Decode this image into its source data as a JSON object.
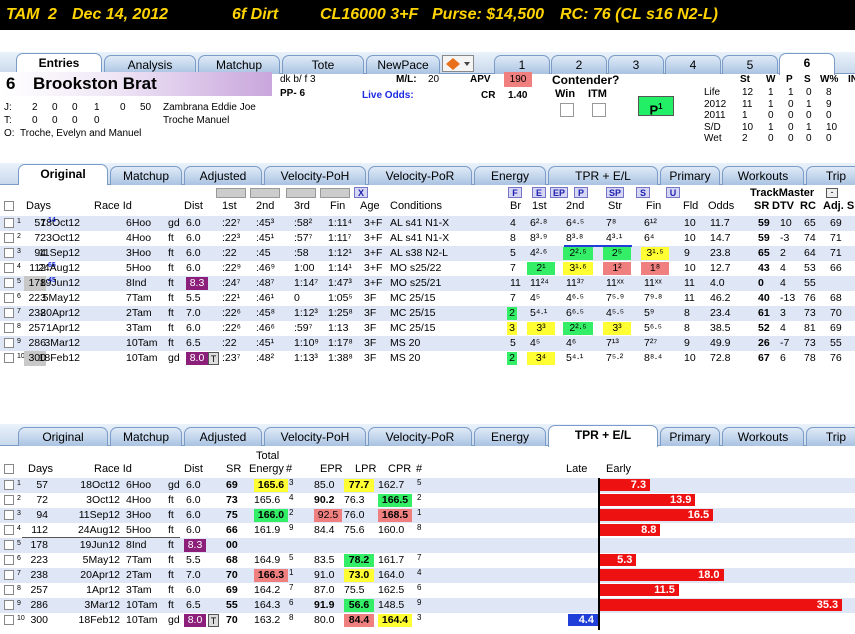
{
  "title": {
    "track": "TAM",
    "race": "2",
    "date": "Dec 14, 2012",
    "dist_surface": "6f  Dirt",
    "class": "CL16000  3+F",
    "purse": "Purse: $14,500",
    "rc": "RC: 76  (CL s16 N2-L)"
  },
  "top_tabs": [
    "Entries",
    "Analysis",
    "Matchup",
    "Tote",
    "NewPace"
  ],
  "race_tabs": [
    "1",
    "2",
    "3",
    "4",
    "5",
    "6"
  ],
  "horse": {
    "number": "6",
    "name": "Brookston Brat",
    "desc": "dk b/ f 3",
    "pp": "PP- 6",
    "ml_label": "M/L:",
    "ml": "20",
    "live_odds": "Live Odds:",
    "apv_label": "APV",
    "apv": "190",
    "cr_label": "CR",
    "cr": "1.40",
    "contender": "Contender?",
    "win": "Win",
    "itm": "ITM",
    "p1": "P",
    "p1_sup": "1",
    "j_label": "J:",
    "j_stats": [
      "2",
      "0",
      "0",
      "1",
      "0",
      "50"
    ],
    "jockey": "Zambrana Eddie Joe",
    "t_label": "T:",
    "t_stats": [
      "0",
      "0",
      "0",
      "0"
    ],
    "trainer": "Troche Manuel",
    "o_label": "O:",
    "owner": "Troche, Evelyn and Manuel"
  },
  "lifetime": {
    "headers": [
      "St",
      "W",
      "P",
      "S",
      "W%",
      "IN"
    ],
    "rows": [
      [
        "Life",
        "12",
        "1",
        "1",
        "0",
        "8"
      ],
      [
        "2012",
        "11",
        "1",
        "0",
        "1",
        "9"
      ],
      [
        "2011",
        "1",
        "0",
        "0",
        "0",
        "0"
      ],
      [
        "S/D",
        "10",
        "1",
        "0",
        "1",
        "10"
      ],
      [
        "Wet",
        "2",
        "0",
        "0",
        "0",
        "0"
      ]
    ]
  },
  "sub_tabs": [
    "Original",
    "Matchup",
    "Adjusted",
    "Velocity-PoH",
    "Velocity-PoR",
    "Energy",
    "TPR + E/L",
    "Primary",
    "Workouts",
    "Trip"
  ],
  "table1": {
    "headers": {
      "days": "Days",
      "raceid": "Race Id",
      "dist": "Dist",
      "q1": "1st",
      "q2": "2nd",
      "q3": "3rd",
      "fin": "Fin",
      "age": "Age",
      "cond": "Conditions",
      "br": "Br",
      "c1": "1st",
      "c2": "2nd",
      "str": "Str",
      "cfin": "Fin",
      "fld": "Fld",
      "odds": "Odds",
      "trackmaster": "TrackMaster",
      "sr": "SR",
      "dtv": "DTV",
      "rc": "RC",
      "adj": "Adj. S"
    },
    "letter_buttons": [
      "F",
      "E",
      "EP",
      "P",
      "SP",
      "S",
      "U"
    ],
    "x_button": "X",
    "rows": [
      {
        "n": "1",
        "days": "57",
        "sup": "14",
        "date": "18Oct12",
        "race": "6Hoo",
        "sf": "gd",
        "dist": "6.0",
        "q1": ":22⁷",
        "q2": ":45³",
        "q3": ":58²",
        "fin": "1:11⁴",
        "age": "3+F",
        "cond": "AL s41 N1-X",
        "br": "4",
        "c1": "6²·⁸",
        "c2": "6⁴·⁵",
        "str": "7⁸",
        "cfin": "6¹²",
        "fld": "10",
        "odds": "11.7",
        "sr": "59",
        "dtv": "10",
        "rc": "65",
        "adj": "69"
      },
      {
        "n": "2",
        "days": "72",
        "sup": "",
        "date": "3Oct12",
        "race": "4Hoo",
        "sf": "ft",
        "dist": "6.0",
        "q1": ":22³",
        "q2": ":45¹",
        "q3": ":57⁷",
        "fin": "1:11⁷",
        "age": "3+F",
        "cond": "AL s41 N1-X",
        "br": "8",
        "c1": "8³·⁹",
        "c2": "8³·⁸",
        "str": "4³·¹",
        "cfin": "6⁴",
        "fld": "10",
        "odds": "14.7",
        "sr": "59",
        "dtv": "-3",
        "rc": "74",
        "adj": "71"
      },
      {
        "n": "3",
        "days": "94",
        "sup": "",
        "date": "11Sep12",
        "race": "3Hoo",
        "sf": "ft",
        "dist": "6.0",
        "q1": ":22",
        "q2": ":45",
        "q3": ":58",
        "fin": "1:12¹",
        "age": "3+F",
        "cond": "AL s38 N2-L",
        "br": "5",
        "c1": "4²·⁶",
        "c2": "2²·⁵",
        "str": "2⁵",
        "cfin": "3¹·⁵",
        "fld": "9",
        "odds": "23.8",
        "sr": "65",
        "dtv": "2",
        "rc": "64",
        "adj": "71"
      },
      {
        "n": "4",
        "days": "112",
        "sup": "65",
        "date": "24Aug12",
        "race": "5Hoo",
        "sf": "ft",
        "dist": "6.0",
        "q1": ":22⁹",
        "q2": ":46⁹",
        "q3": "1:00",
        "fin": "1:14¹",
        "age": "3+F",
        "cond": "MO s25/22",
        "br": "7",
        "c1": "2¹",
        "c2": "3¹·⁶",
        "str": "1²",
        "cfin": "1⁸",
        "fld": "10",
        "odds": "12.7",
        "sr": "43",
        "dtv": "4",
        "rc": "53",
        "adj": "66"
      },
      {
        "n": "5",
        "days": "178",
        "sup": "45",
        "date": "19Jun12",
        "race": "8Ind",
        "sf": "ft",
        "dist": "8.3",
        "q1": ":24⁷",
        "q2": ":48⁷",
        "q3": "1:14⁷",
        "fin": "1:47³",
        "age": "3+F",
        "cond": "MO s25/21",
        "br": "11",
        "c1": "11²⁴",
        "c2": "11³⁷",
        "str": "11ˣˣ",
        "cfin": "11ˣˣ",
        "fld": "11",
        "odds": "4.0",
        "sr": "0",
        "dtv": "4",
        "rc": "55",
        "adj": ""
      },
      {
        "n": "6",
        "days": "223",
        "sup": "",
        "date": "5May12",
        "race": "7Tam",
        "sf": "ft",
        "dist": "5.5",
        "q1": ":22¹",
        "q2": ":46¹",
        "q3": "0",
        "fin": "1:05⁵",
        "age": "3F",
        "cond": "MC 25/15",
        "br": "7",
        "c1": "4⁵",
        "c2": "4⁶·⁵",
        "str": "7⁵·⁹",
        "cfin": "7⁹·⁸",
        "fld": "11",
        "odds": "46.2",
        "sr": "40",
        "dtv": "-13",
        "rc": "76",
        "adj": "68"
      },
      {
        "n": "7",
        "days": "238",
        "sup": "",
        "date": "20Apr12",
        "race": "2Tam",
        "sf": "ft",
        "dist": "7.0",
        "q1": ":22⁶",
        "q2": ":45⁸",
        "q3": "1:12³",
        "fin": "1:25⁸",
        "age": "3F",
        "cond": "MC 25/15",
        "br": "2",
        "c1": "5⁴·¹",
        "c2": "6⁶·⁵",
        "str": "4⁵·⁵",
        "cfin": "5⁹",
        "fld": "8",
        "odds": "23.4",
        "sr": "61",
        "dtv": "3",
        "rc": "73",
        "adj": "70"
      },
      {
        "n": "8",
        "days": "257",
        "sup": "",
        "date": "1Apr12",
        "race": "3Tam",
        "sf": "ft",
        "dist": "6.0",
        "q1": ":22⁶",
        "q2": ":46⁶",
        "q3": ":59⁷",
        "fin": "1:13",
        "age": "3F",
        "cond": "MC 25/15",
        "br": "3",
        "c1": "3³",
        "c2": "2²·⁵",
        "str": "3³",
        "cfin": "5⁶·⁵",
        "fld": "8",
        "odds": "38.5",
        "sr": "52",
        "dtv": "4",
        "rc": "81",
        "adj": "69"
      },
      {
        "n": "9",
        "days": "286",
        "sup": "",
        "date": "3Mar12",
        "race": "10Tam",
        "sf": "ft",
        "dist": "6.5",
        "q1": ":22",
        "q2": ":45¹",
        "q3": "1:10⁹",
        "fin": "1:17⁸",
        "age": "3F",
        "cond": "MS 20",
        "br": "5",
        "c1": "4⁵",
        "c2": "4⁶",
        "str": "7¹³",
        "cfin": "7²⁷",
        "fld": "9",
        "odds": "49.9",
        "sr": "26",
        "dtv": "-7",
        "rc": "73",
        "adj": "55"
      },
      {
        "n": "10",
        "days": "300",
        "sup": "",
        "date": "18Feb12",
        "race": "10Tam",
        "sf": "gd",
        "dist": "8.0",
        "q1": ":23⁷",
        "q2": ":48²",
        "q3": "1:13³",
        "fin": "1:38⁸",
        "age": "3F",
        "cond": "MS 20",
        "br": "2",
        "c1": "3⁴",
        "c2": "5⁴·¹",
        "str": "7⁵·²",
        "cfin": "8⁸·⁴",
        "fld": "10",
        "odds": "72.8",
        "sr": "67",
        "dtv": "6",
        "rc": "78",
        "adj": "76"
      }
    ]
  },
  "table2": {
    "headers": {
      "days": "Days",
      "raceid": "Race Id",
      "dist": "Dist",
      "sr": "SR",
      "total": "Total",
      "energy": "Energy",
      "hash": "#",
      "epr": "EPR",
      "lpr": "LPR",
      "cpr": "CPR",
      "hash2": "#",
      "late": "Late",
      "early": "Early"
    },
    "t_badge": "T",
    "rows": [
      {
        "n": "1",
        "days": "57",
        "date": "18Oct12",
        "race": "6Hoo",
        "sf": "gd",
        "dist": "6.0",
        "sr": "69",
        "te": "165.6",
        "ter": "3",
        "epr": "85.0",
        "lpr": "77.7",
        "cpr": "162.7",
        "cprr": "5",
        "early": 7.3,
        "early_label": "7.3",
        "late": 0,
        "late_label": ""
      },
      {
        "n": "2",
        "days": "72",
        "date": "3Oct12",
        "race": "4Hoo",
        "sf": "ft",
        "dist": "6.0",
        "sr": "73",
        "te": "165.6",
        "ter": "4",
        "epr": "90.2",
        "lpr": "76.3",
        "cpr": "166.5",
        "cprr": "2",
        "early": 13.9,
        "early_label": "13.9",
        "late": 0,
        "late_label": ""
      },
      {
        "n": "3",
        "days": "94",
        "date": "11Sep12",
        "race": "3Hoo",
        "sf": "ft",
        "dist": "6.0",
        "sr": "75",
        "te": "166.0",
        "ter": "2",
        "epr": "92.5",
        "lpr": "76.0",
        "cpr": "168.5",
        "cprr": "1",
        "early": 16.5,
        "early_label": "16.5",
        "late": 0,
        "late_label": ""
      },
      {
        "n": "4",
        "days": "112",
        "date": "24Aug12",
        "race": "5Hoo",
        "sf": "ft",
        "dist": "6.0",
        "sr": "66",
        "te": "161.9",
        "ter": "9",
        "epr": "84.4",
        "lpr": "75.6",
        "cpr": "160.0",
        "cprr": "8",
        "early": 8.8,
        "early_label": "8.8",
        "late": 0,
        "late_label": ""
      },
      {
        "n": "5",
        "days": "178",
        "date": "19Jun12",
        "race": "8Ind",
        "sf": "ft",
        "dist": "8.3",
        "sr": "00",
        "te": "",
        "ter": "",
        "epr": "",
        "lpr": "",
        "cpr": "",
        "cprr": "",
        "early": 0,
        "early_label": "",
        "late": 0,
        "late_label": ""
      },
      {
        "n": "6",
        "days": "223",
        "date": "5May12",
        "race": "7Tam",
        "sf": "ft",
        "dist": "5.5",
        "sr": "68",
        "te": "164.9",
        "ter": "5",
        "epr": "83.5",
        "lpr": "78.2",
        "cpr": "161.7",
        "cprr": "7",
        "early": 5.3,
        "early_label": "5.3",
        "late": 0,
        "late_label": ""
      },
      {
        "n": "7",
        "days": "238",
        "date": "20Apr12",
        "race": "2Tam",
        "sf": "ft",
        "dist": "7.0",
        "sr": "70",
        "te": "166.3",
        "ter": "1",
        "epr": "91.0",
        "lpr": "73.0",
        "cpr": "164.0",
        "cprr": "4",
        "early": 18.0,
        "early_label": "18.0",
        "late": 0,
        "late_label": ""
      },
      {
        "n": "8",
        "days": "257",
        "date": "1Apr12",
        "race": "3Tam",
        "sf": "ft",
        "dist": "6.0",
        "sr": "69",
        "te": "164.2",
        "ter": "7",
        "epr": "87.0",
        "lpr": "75.5",
        "cpr": "162.5",
        "cprr": "6",
        "early": 11.5,
        "early_label": "11.5",
        "late": 0,
        "late_label": ""
      },
      {
        "n": "9",
        "days": "286",
        "date": "3Mar12",
        "race": "10Tam",
        "sf": "ft",
        "dist": "6.5",
        "sr": "55",
        "te": "164.3",
        "ter": "6",
        "epr": "91.9",
        "lpr": "56.6",
        "cpr": "148.5",
        "cprr": "9",
        "early": 35.3,
        "early_label": "35.3",
        "late": 0,
        "late_label": ""
      },
      {
        "n": "10",
        "days": "300",
        "date": "18Feb12",
        "race": "10Tam",
        "sf": "gd",
        "dist": "8.0",
        "sr": "70",
        "te": "163.2",
        "ter": "8",
        "epr": "80.0",
        "lpr": "84.4",
        "cpr": "164.4",
        "cprr": "3",
        "early": 0,
        "early_label": "",
        "late": 4.4,
        "late_label": "4.4"
      }
    ]
  },
  "colors": {
    "red_bar": "#ee1111",
    "blue_bar": "#1f3fd8",
    "yellow": "#ffff33",
    "green": "#33ee66",
    "pink": "#f08080",
    "purple": "#8b1f7a"
  }
}
